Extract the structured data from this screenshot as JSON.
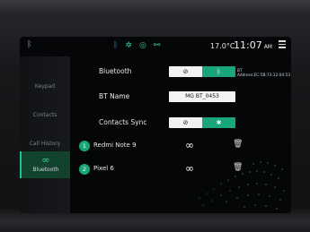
{
  "statusbar": {
    "bt_icon": "bluetooth-icon",
    "icons": [
      "bluetooth-icon",
      "gear-icon",
      "sync-icon",
      "car-icon"
    ],
    "temperature": "17.0°C",
    "time": "11:07",
    "time_suffix": "AM",
    "menu_icon": "hamburger-menu-icon"
  },
  "sidebar": {
    "items": [
      {
        "label": "Keypad"
      },
      {
        "label": "Contacts"
      },
      {
        "label": "Call History"
      },
      {
        "label": "Bluetooth",
        "icon": "link-icon",
        "active": true
      }
    ]
  },
  "settings": {
    "bluetooth": {
      "label": "Bluetooth",
      "off_symbol": "⊘",
      "on_symbol": "ᛒ",
      "address": "BT Address:EC:5B:73:12:04:53"
    },
    "bt_name": {
      "label": "BT Name",
      "value": "MG BT_0453"
    },
    "contacts_sync": {
      "label": "Contacts Sync",
      "off_symbol": "⊘",
      "on_symbol": "✱"
    }
  },
  "devices": [
    {
      "index": "1",
      "name": "Redmi Note 9",
      "link_icon": "link-icon",
      "delete_icon": "trash-icon"
    },
    {
      "index": "2",
      "name": "Pixel 6",
      "link_icon": "link-icon",
      "delete_icon": "trash-icon"
    }
  ],
  "colors": {
    "accent": "#1aa57a",
    "active_bg": "#11432f"
  }
}
